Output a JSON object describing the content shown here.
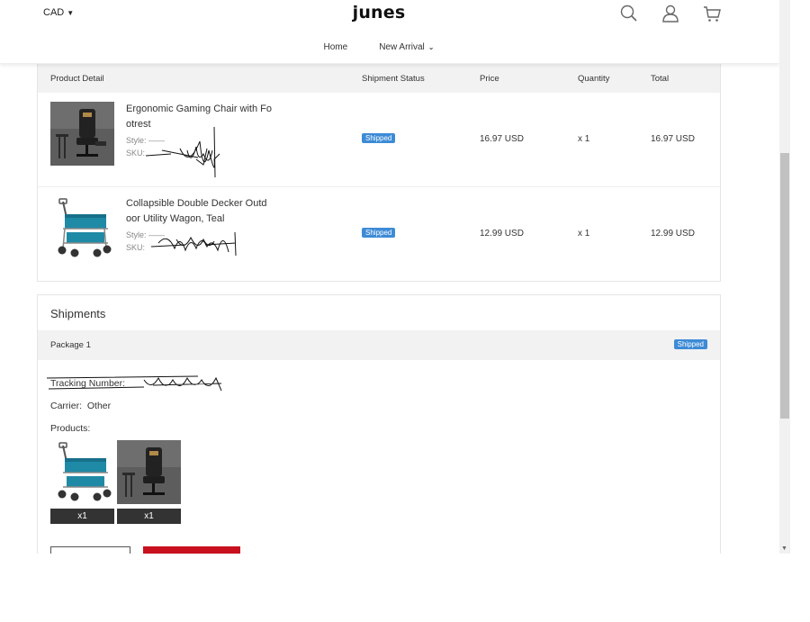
{
  "header": {
    "currency": "CAD",
    "logo": "junes",
    "nav": [
      "Home",
      "New Arrival"
    ],
    "icons": [
      "search-icon",
      "user-icon",
      "cart-icon"
    ]
  },
  "table": {
    "columns": [
      "Product Detail",
      "Shipment Status",
      "Price",
      "Quantity",
      "Total"
    ],
    "rows": [
      {
        "name_line1": "Ergonomic Gaming Chair with Fo",
        "name_line2": "otrest",
        "style": "Style: ——",
        "sku": "SKU: ",
        "status": "Shipped",
        "price": "16.97 USD",
        "qty": "x 1",
        "total": "16.97 USD"
      },
      {
        "name_line1": "Collapsible Double Decker Outd",
        "name_line2": "oor Utility Wagon, Teal",
        "style": "Style: ——",
        "sku": "SKU: ",
        "status": "Shipped",
        "price": "12.99 USD",
        "qty": "x 1",
        "total": "12.99 USD"
      }
    ]
  },
  "shipments": {
    "title": "Shipments",
    "package_label": "Package 1",
    "package_status": "Shipped",
    "tracking_label": "Tracking Number:",
    "carrier_label": "Carrier:",
    "carrier_value": "Other",
    "products_label": "Products:",
    "products": [
      {
        "qty": "x1",
        "kind": "wagon"
      },
      {
        "qty": "x1",
        "kind": "chair"
      }
    ]
  },
  "colors": {
    "badge": "#3d8bd6",
    "red_button": "#c8101e",
    "header_bg": "#f2f2f2"
  }
}
